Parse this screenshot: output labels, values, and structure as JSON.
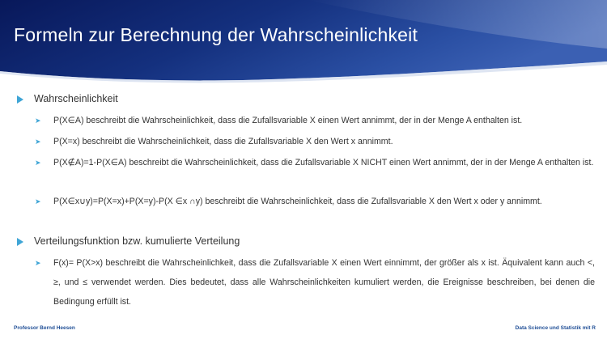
{
  "slide": {
    "title": "Formeln zur Berechnung der Wahrscheinlichkeit",
    "colors": {
      "header_dark": "#0a1a5c",
      "header_mid": "#1c3d8f",
      "accent": "#3fa5d6",
      "text": "#333333",
      "footer": "#1f4e96"
    }
  },
  "content": {
    "sections": [
      {
        "heading": "Wahrscheinlichkeit",
        "items": [
          "P(X∈A) beschreibt die Wahrscheinlichkeit, dass die Zufallsvariable X einen Wert annimmt, der in der Menge A enthalten ist.",
          "P(X=x) beschreibt die Wahrscheinlichkeit, dass die Zufallsvariable X den Wert x annimmt.",
          "P(X∉A)=1-P(X∈A) beschreibt die Wahrscheinlichkeit, dass die Zufallsvariable X NICHT einen Wert annimmt, der in der Menge A enthalten ist.",
          "P(X∈x∪y)=P(X=x)+P(X=y)-P(X ∈x ∩y) beschreibt die Wahrscheinlichkeit, dass die Zufallsvariable X den Wert x oder y annimmt."
        ]
      },
      {
        "heading": "Verteilungsfunktion bzw. kumulierte Verteilung",
        "items": [
          "F(x)= P(X>x) beschreibt die Wahrscheinlichkeit, dass die Zufallsvariable X einen Wert einnimmt, der größer als x ist. Äquivalent kann auch <, ≥, und ≤ verwendet werden. Dies bedeutet, dass alle Wahrscheinlichkeiten kumuliert werden, die Ereignisse beschreiben, bei denen die Bedingung erfüllt ist."
        ]
      }
    ]
  },
  "footer": {
    "left": "Professor Bernd Heesen",
    "right": "Data Science und Statistik mit R"
  }
}
